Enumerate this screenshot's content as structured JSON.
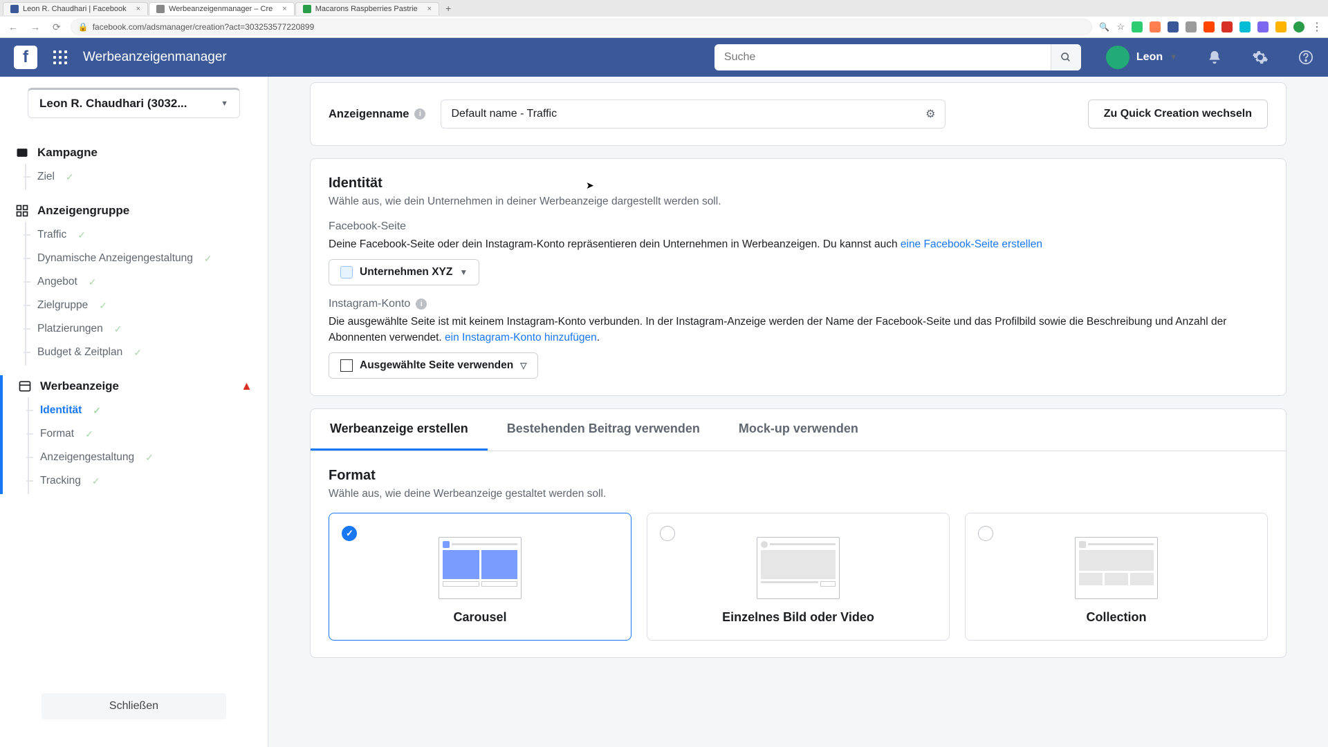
{
  "browser": {
    "tabs": [
      {
        "label": "Leon R. Chaudhari | Facebook",
        "favicon": "#3b5998"
      },
      {
        "label": "Werbeanzeigenmanager – Cre",
        "favicon": "#888"
      },
      {
        "label": "Macarons Raspberries Pastrie",
        "favicon": "#2a9d4a"
      }
    ],
    "url": "facebook.com/adsmanager/creation?act=303253577220899"
  },
  "header": {
    "title": "Werbeanzeigenmanager",
    "search_placeholder": "Suche",
    "user_name": "Leon"
  },
  "sidebar": {
    "account": "Leon R. Chaudhari (3032...",
    "close": "Schließen",
    "kampagne": {
      "label": "Kampagne",
      "items": [
        "Ziel"
      ]
    },
    "anzeigengruppe": {
      "label": "Anzeigengruppe",
      "items": [
        "Traffic",
        "Dynamische Anzeigengestaltung",
        "Angebot",
        "Zielgruppe",
        "Platzierungen",
        "Budget & Zeitplan"
      ]
    },
    "werbeanzeige": {
      "label": "Werbeanzeige",
      "items": [
        "Identität",
        "Format",
        "Anzeigengestaltung",
        "Tracking"
      ]
    }
  },
  "top": {
    "name_label": "Anzeigenname",
    "name_value": "Default name - Traffic",
    "quick": "Zu Quick Creation wechseln"
  },
  "identity": {
    "heading": "Identität",
    "subtitle": "Wähle aus, wie dein Unternehmen in deiner Werbeanzeige dargestellt werden soll.",
    "fb_label": "Facebook-Seite",
    "fb_text": "Deine Facebook-Seite oder dein Instagram-Konto repräsentieren dein Unternehmen in Werbeanzeigen. Du kannst auch ",
    "fb_link": "eine Facebook-Seite erstellen",
    "page_name": "Unternehmen XYZ",
    "ig_label": "Instagram-Konto",
    "ig_text_a": "Die ausgewählte Seite ist mit keinem Instagram-Konto verbunden. In der Instagram-Anzeige werden der Name der Facebook-Seite und das Profilbild sowie die Beschreibung und Anzahl der Abonnenten verwendet. ",
    "ig_link": "ein Instagram-Konto hinzufügen",
    "ig_btn": "Ausgewählte Seite verwenden"
  },
  "tabs": {
    "t1": "Werbeanzeige erstellen",
    "t2": "Bestehenden Beitrag verwenden",
    "t3": "Mock-up verwenden"
  },
  "format": {
    "heading": "Format",
    "subtitle": "Wähle aus, wie deine Werbeanzeige gestaltet werden soll.",
    "opts": [
      "Carousel",
      "Einzelnes Bild oder Video",
      "Collection"
    ]
  }
}
